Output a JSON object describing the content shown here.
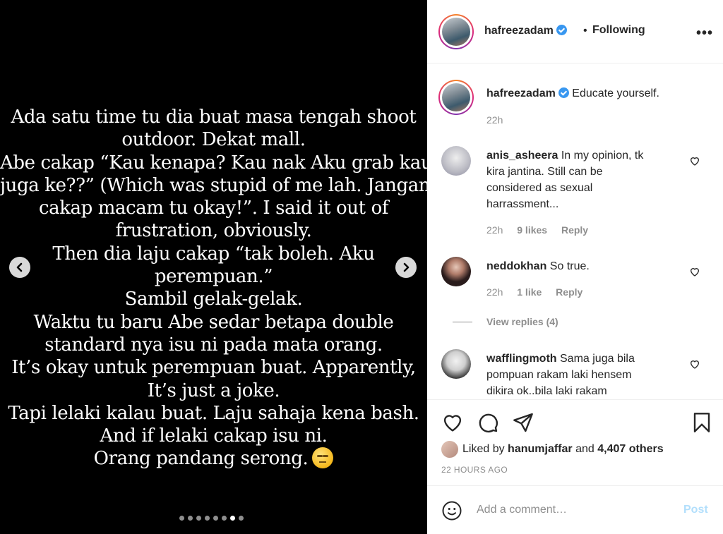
{
  "story": {
    "lines": [
      "Ada satu time tu dia buat masa tengah shoot",
      "outdoor. Dekat mall.",
      "Abe cakap “Kau kenapa? Kau nak Aku grab kau",
      "juga ke??” (Which was stupid of me lah. Jangan",
      "cakap macam tu okay!”. I said it out of",
      "frustration, obviously.",
      "Then dia laju cakap “tak boleh. Aku",
      "perempuan.”",
      "Sambil gelak-gelak.",
      "Waktu tu baru Abe sedar betapa double",
      "standard nya isu ni pada mata orang.",
      "It’s okay untuk perempuan buat. Apparently,",
      "It’s just a joke.",
      "Tapi lelaki kalau buat. Laju sahaja kena bash.",
      "And if lelaki cakap isu ni.",
      "Orang pandang serong."
    ],
    "emoji_icon": "expressionless-face-icon",
    "carousel_total": 8,
    "carousel_active": 7
  },
  "header": {
    "username": "hafreezadam",
    "separator": "•",
    "follow_status": "Following",
    "more": "•••"
  },
  "caption": {
    "username": "hafreezadam",
    "text": "Educate yourself.",
    "time": "22h"
  },
  "comments": [
    {
      "username": "anis_asheera",
      "text_lines": [
        "In my opinion, tk",
        "kira jantina. Still can be",
        "considered as sexual",
        "harrassment..."
      ],
      "time": "22h",
      "likes": "9 likes",
      "reply": "Reply"
    },
    {
      "username": "neddokhan",
      "text_lines": [
        "So true."
      ],
      "time": "22h",
      "likes": "1 like",
      "reply": "Reply",
      "view_replies": "View replies (4)"
    },
    {
      "username": "wafflingmoth",
      "text_lines": [
        "Sama juga bila",
        "pompuan rakam laki hensem",
        "dikira ok..bila laki rakam"
      ]
    }
  ],
  "likes": {
    "prefix": "Liked by",
    "user": "hanumjaffar",
    "and": "and",
    "others": "4,407 others"
  },
  "timeago": "22 HOURS AGO",
  "add_comment": {
    "placeholder": "Add a comment…",
    "post": "Post"
  }
}
